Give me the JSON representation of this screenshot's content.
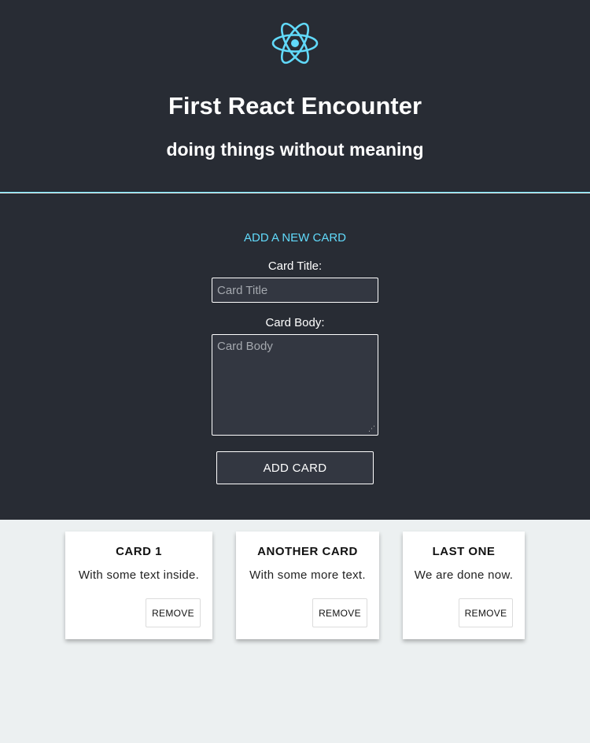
{
  "header": {
    "logo_icon": "react-atom-icon",
    "logo_color": "#61dafb",
    "title": "First React Encounter",
    "subtitle": "doing things without meaning"
  },
  "form": {
    "heading": "ADD A NEW CARD",
    "title_label": "Card Title:",
    "title_placeholder": "Card Title",
    "title_value": "",
    "body_label": "Card Body:",
    "body_placeholder": "Card Body",
    "body_value": "",
    "submit_label": "ADD CARD"
  },
  "cards": [
    {
      "title": "CARD 1",
      "body": "With some text inside.",
      "remove_label": "REMOVE"
    },
    {
      "title": "ANOTHER CARD",
      "body": "With some more text.",
      "remove_label": "REMOVE"
    },
    {
      "title": "LAST ONE",
      "body": "We are done now.",
      "remove_label": "REMOVE"
    }
  ],
  "colors": {
    "header_bg": "#282c34",
    "accent": "#61dafb",
    "page_bg": "#ecf0f1"
  }
}
